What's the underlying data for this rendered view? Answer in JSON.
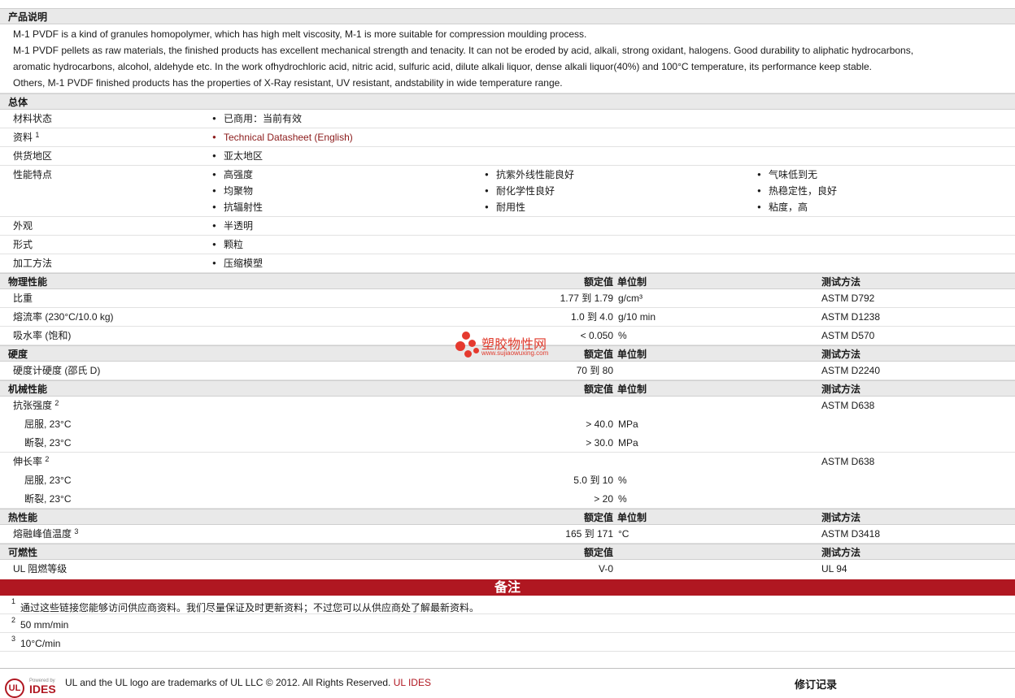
{
  "sections": {
    "description": {
      "title": "产品说明",
      "lines": [
        "M-1 PVDF is a kind of granules homopolymer, which has high melt viscosity, M-1 is more suitable for compression moulding process.",
        "M-1 PVDF pellets as raw materials, the finished products has excellent mechanical strength and tenacity. It can not be eroded by acid, alkali, strong oxidant, halogens. Good durability to aliphatic hydrocarbons,",
        "aromatic hydrocarbons, alcohol, aldehyde etc. In the work ofhydrochloric acid, nitric acid, sulfuric acid, dilute alkali liquor, dense alkali liquor(40%) and 100°C temperature, its performance keep stable.",
        "Others, M-1 PVDF finished products has the properties of X-Ray resistant, UV resistant, andstability in wide temperature range."
      ]
    },
    "general": {
      "title": "总体",
      "status_label": "材料状态",
      "status_value": "已商用：当前有效",
      "docs_label": "资料",
      "docs_sup": "1",
      "docs_link": "Technical Datasheet (English)",
      "supply_label": "供货地区",
      "supply_value": "亚太地区",
      "features_label": "性能特点",
      "features": [
        "高强度",
        "均聚物",
        "抗辐射性",
        "抗紫外线性能良好",
        "耐化学性良好",
        "耐用性",
        "气味低到无",
        "热稳定性，良好",
        "粘度，高"
      ],
      "appearance_label": "外观",
      "appearance_value": "半透明",
      "form_label": "形式",
      "form_value": "颗粒",
      "process_label": "加工方法",
      "process_value": "压缩模塑"
    },
    "headers": {
      "rated": "额定值",
      "unit": "单位制",
      "method": "测试方法"
    },
    "physical": {
      "title": "物理性能",
      "rows": [
        {
          "label": "比重",
          "value": "1.77 到  1.79",
          "unit": "g/cm³",
          "method": "ASTM D792"
        },
        {
          "label": "熔流率  (230°C/10.0 kg)",
          "value": "1.0 到  4.0",
          "unit": "g/10 min",
          "method": "ASTM D1238"
        },
        {
          "label": "吸水率  (饱和)",
          "value": "< 0.050",
          "unit": "%",
          "method": "ASTM D570"
        }
      ]
    },
    "hardness": {
      "title": "硬度",
      "rows": [
        {
          "label": "硬度计硬度  (邵氏  D)",
          "value": "70 到  80",
          "unit": "",
          "method": "ASTM D2240"
        }
      ]
    },
    "mechanical": {
      "title": "机械性能",
      "tensile_label": "抗张强度",
      "tensile_sup": "2",
      "tensile_method": "ASTM D638",
      "tensile_rows": [
        {
          "label": "屈服, 23°C",
          "value": "> 40.0",
          "unit": "MPa"
        },
        {
          "label": "断裂, 23°C",
          "value": "> 30.0",
          "unit": "MPa"
        }
      ],
      "elong_label": "伸长率",
      "elong_sup": "2",
      "elong_method": "ASTM D638",
      "elong_rows": [
        {
          "label": "屈服, 23°C",
          "value": "5.0 到  10",
          "unit": "%"
        },
        {
          "label": "断裂, 23°C",
          "value": "> 20",
          "unit": "%"
        }
      ]
    },
    "thermal": {
      "title": "热性能",
      "rows": [
        {
          "label": "熔融峰值温度",
          "sup": "3",
          "value": "165 到  171",
          "unit": "°C",
          "method": "ASTM D3418"
        }
      ]
    },
    "flammability": {
      "title": "可燃性",
      "rows": [
        {
          "label": "UL 阻燃等级",
          "value": "V-0",
          "unit": "",
          "method": "UL 94"
        }
      ]
    }
  },
  "notes": {
    "title": "备注",
    "items": [
      {
        "num": "1",
        "text": "通过这些链接您能够访问供应商资料。我们尽量保证及时更新资料；不过您可以从供应商处了解最新资料。"
      },
      {
        "num": "2",
        "text": "50 mm/min"
      },
      {
        "num": "3",
        "text": "10°C/min"
      }
    ]
  },
  "watermark": {
    "cn": "塑胶物性网",
    "en": "www.sujiaowuxing.com"
  },
  "footer": {
    "logo_text": "UL",
    "powered": "Powered by",
    "ides": "IDES",
    "trademark": "UL and the UL logo are trademarks of UL LLC © 2012. All Rights Reserved.",
    "ul_ides_link": "UL IDES",
    "revision": "修订记录"
  },
  "colors": {
    "accent": "#b01721",
    "link": "#8b1a1a",
    "section_bg": "#e9e9e9"
  }
}
